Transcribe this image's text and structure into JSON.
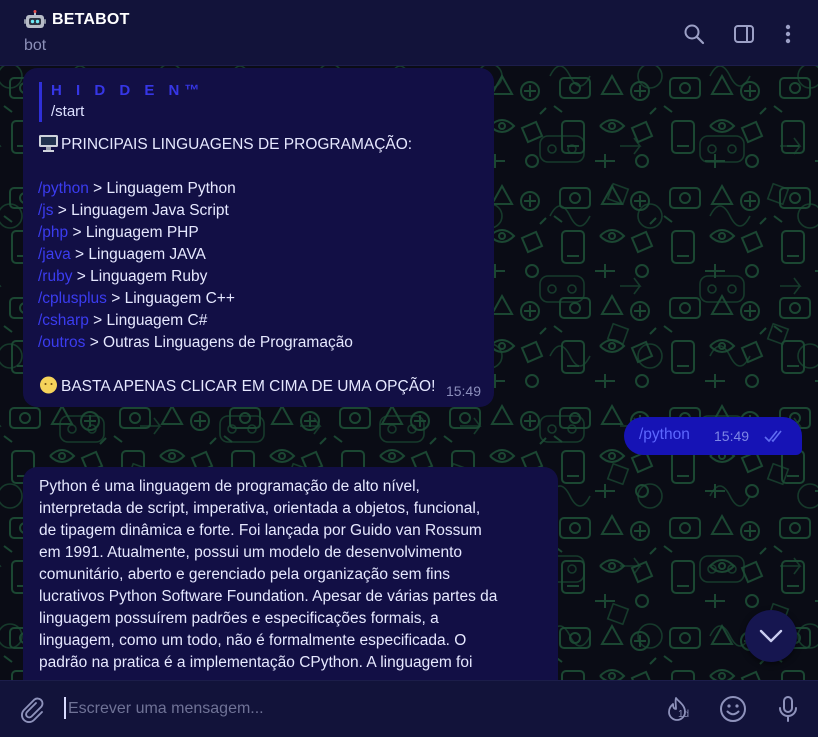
{
  "header": {
    "title": "BETABOT",
    "subtitle": "bot"
  },
  "messages": {
    "first": {
      "reply_name": "H I D D E N™",
      "reply_text": "/start",
      "heading": "PRINCIPAIS LINGUAGENS DE PROGRAMAÇÃO:",
      "commands": [
        {
          "cmd": "/python",
          "desc": " > Linguagem Python"
        },
        {
          "cmd": "/js",
          "desc": " > Linguagem Java Script"
        },
        {
          "cmd": "/php",
          "desc": " > Linguagem PHP"
        },
        {
          "cmd": "/java",
          "desc": " > Linguagem JAVA"
        },
        {
          "cmd": "/ruby",
          "desc": " > Linguagem Ruby"
        },
        {
          "cmd": "/cplusplus",
          "desc": " > Linguagem C++"
        },
        {
          "cmd": "/csharp",
          "desc": " > Linguagem C#"
        },
        {
          "cmd": "/outros",
          "desc": " > Outras Linguagens de Programação"
        }
      ],
      "footer": "BASTA APENAS CLICAR EM CIMA DE UMA OPÇÃO!",
      "time": "15:49"
    },
    "outgoing": {
      "text": "/python",
      "time": "15:49"
    },
    "python_info": {
      "lines": [
        "Python é uma linguagem de programação de alto nível,",
        "interpretada de script, imperativa, orientada a objetos, funcional,",
        "de tipagem dinâmica e forte. Foi lançada por Guido van Rossum",
        "em 1991. Atualmente, possui um modelo de desenvolvimento",
        "comunitário, aberto e gerenciado pela organização sem fins",
        "lucrativos Python Software Foundation. Apesar de várias partes da",
        "linguagem possuírem padrões e especificações formais, a",
        "linguagem, como um todo, não é formalmente especificada. O",
        "padrão na pratica é a implementação CPython. A linguagem foi"
      ]
    }
  },
  "input": {
    "placeholder": "Escrever uma mensagem...",
    "timer_label": "1d"
  },
  "icons": {
    "header": [
      "robot-emoji",
      "search-icon",
      "sidebar-toggle-icon",
      "more-vertical-icon"
    ],
    "input": [
      "paperclip-icon",
      "timer-icon",
      "emoji-icon",
      "microphone-icon"
    ]
  },
  "colors": {
    "header_bg": "#12133a",
    "bubble_in": "#120f45",
    "bubble_out": "#1613b5",
    "link": "#3b3cf0",
    "accent": "#3636e6"
  }
}
